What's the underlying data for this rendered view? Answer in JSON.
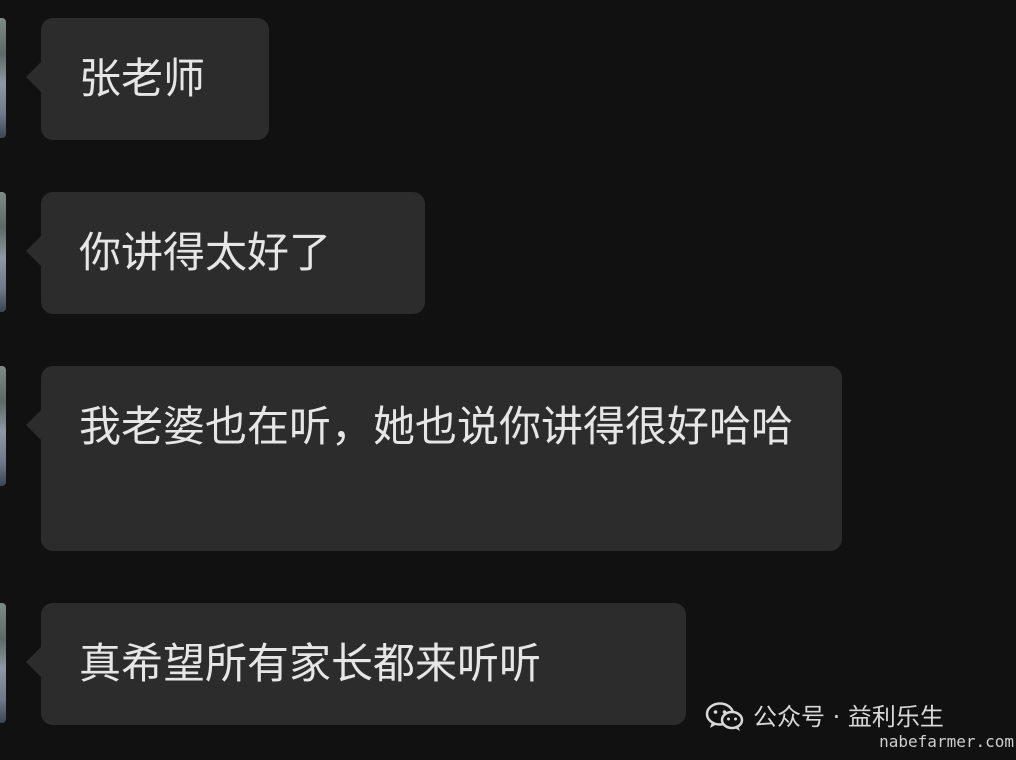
{
  "messages": [
    {
      "text": "张老师"
    },
    {
      "text": "你讲得太好了"
    },
    {
      "text": "我老婆也在听，她也说你讲得很好哈哈"
    },
    {
      "text": "真希望所有家长都来听听"
    }
  ],
  "watermark": {
    "icon": "wechat-icon",
    "label": "公众号 · 益利乐生"
  },
  "site": "nabefarmer.com",
  "colors": {
    "background": "#111111",
    "bubble": "#2c2c2c",
    "text": "#e6e6e6"
  }
}
